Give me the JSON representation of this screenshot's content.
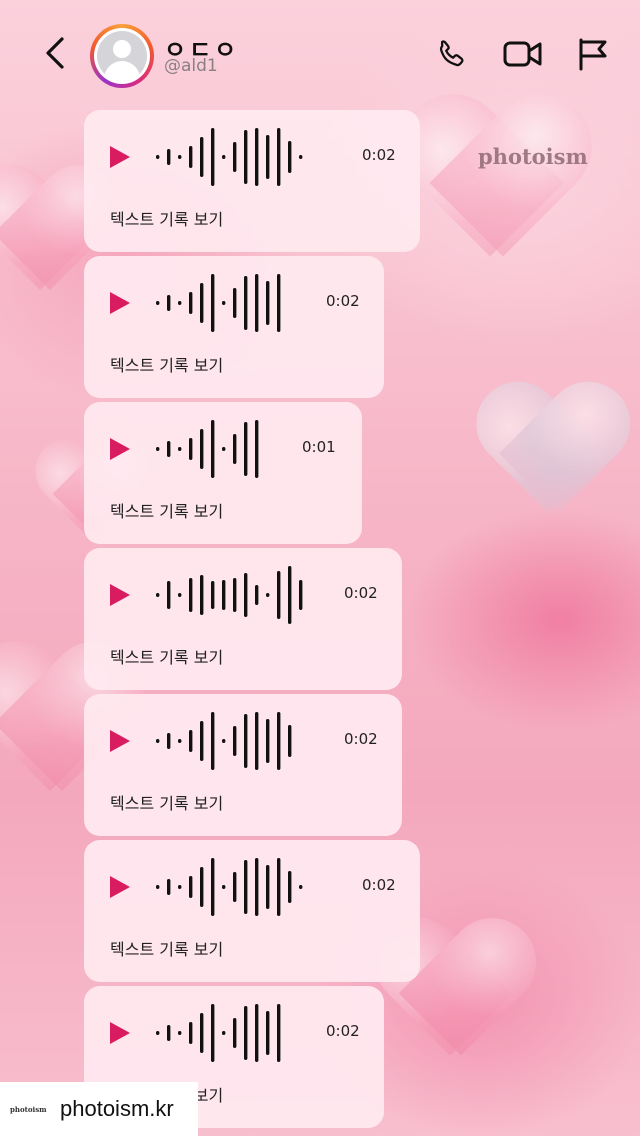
{
  "header": {
    "name": "ㅇㄷㅇ",
    "handle": "@ald1",
    "icons": [
      "back-icon",
      "avatar",
      "phone-icon",
      "video-icon",
      "flag-icon"
    ]
  },
  "watermark": "photoism",
  "messages": [
    {
      "duration": "0:02",
      "transcript_label": "텍스트 기록 보기"
    },
    {
      "duration": "0:02",
      "transcript_label": "텍스트 기록 보기"
    },
    {
      "duration": "0:01",
      "transcript_label": "텍스트 기록 보기"
    },
    {
      "duration": "0:02",
      "transcript_label": "텍스트 기록 보기"
    },
    {
      "duration": "0:02",
      "transcript_label": "텍스트 기록 보기"
    },
    {
      "duration": "0:02",
      "transcript_label": "텍스트 기록 보기"
    },
    {
      "duration": "0:02",
      "transcript_label": "텍스트 기록 보기"
    }
  ],
  "footer": {
    "logo_text": "photoism",
    "site": "photoism.kr"
  },
  "colors": {
    "play": "#d81c5f",
    "bubble": "#ffe9f0",
    "background": "#f6b9c9"
  }
}
